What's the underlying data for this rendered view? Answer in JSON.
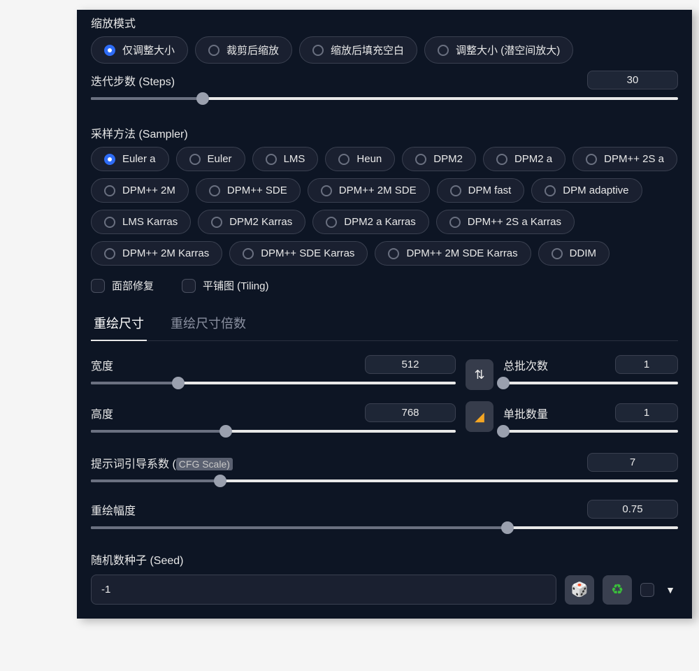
{
  "resize_mode": {
    "label": "缩放模式",
    "options": [
      "仅调整大小",
      "裁剪后缩放",
      "缩放后填充空白",
      "调整大小 (潜空间放大)"
    ],
    "selected": 0
  },
  "steps": {
    "label": "迭代步数 (Steps)",
    "value": "30",
    "fill_pct": 19
  },
  "sampler": {
    "label": "采样方法 (Sampler)",
    "options": [
      "Euler a",
      "Euler",
      "LMS",
      "Heun",
      "DPM2",
      "DPM2 a",
      "DPM++ 2S a",
      "DPM++ 2M",
      "DPM++ SDE",
      "DPM++ 2M SDE",
      "DPM fast",
      "DPM adaptive",
      "LMS Karras",
      "DPM2 Karras",
      "DPM2 a Karras",
      "DPM++ 2S a Karras",
      "DPM++ 2M Karras",
      "DPM++ SDE Karras",
      "DPM++ 2M SDE Karras",
      "DDIM"
    ],
    "selected": 0
  },
  "check_face": {
    "label": "面部修复"
  },
  "check_tiling": {
    "label": "平铺图 (Tiling)"
  },
  "tabs": {
    "items": [
      "重绘尺寸",
      "重绘尺寸倍数"
    ],
    "active": 0
  },
  "width": {
    "label": "宽度",
    "value": "512",
    "fill_pct": 24
  },
  "height": {
    "label": "高度",
    "value": "768",
    "fill_pct": 37
  },
  "batch_count": {
    "label": "总批次数",
    "value": "1",
    "fill_pct": 0
  },
  "batch_size": {
    "label": "单批数量",
    "value": "1",
    "fill_pct": 0
  },
  "cfg": {
    "label": "提示词引导系数 (",
    "hint": "CFG Scale)",
    "value": "7",
    "fill_pct": 22
  },
  "denoise": {
    "label": "重绘幅度",
    "value": "0.75",
    "fill_pct": 71
  },
  "seed": {
    "label": "随机数种子 (Seed)",
    "value": "-1"
  },
  "icons": {
    "swap": "⇅",
    "triangle": "◣",
    "dice": "🎲",
    "recycle": "♻",
    "caret": "▼"
  }
}
